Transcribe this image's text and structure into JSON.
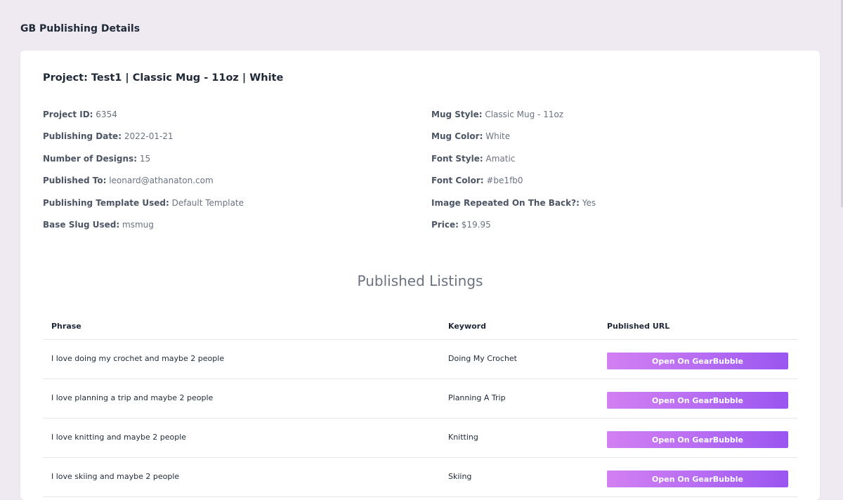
{
  "page": {
    "header": "GB Publishing Details"
  },
  "project": {
    "title": "Project: Test1 | Classic Mug - 11oz | White",
    "left_details": [
      {
        "label": "Project ID:",
        "value": "6354"
      },
      {
        "label": "Publishing Date:",
        "value": "2022-01-21"
      },
      {
        "label": "Number of Designs:",
        "value": "15"
      },
      {
        "label": "Published To:",
        "value": "leonard@athanaton.com"
      },
      {
        "label": "Publishing Template Used:",
        "value": "Default Template"
      },
      {
        "label": "Base Slug Used:",
        "value": "msmug"
      }
    ],
    "right_details": [
      {
        "label": "Mug Style:",
        "value": "Classic Mug - 11oz"
      },
      {
        "label": "Mug Color:",
        "value": "White"
      },
      {
        "label": "Font Style:",
        "value": "Amatic"
      },
      {
        "label": "Font Color:",
        "value": "#be1fb0"
      },
      {
        "label": "Image Repeated On The Back?:",
        "value": "Yes"
      },
      {
        "label": "Price:",
        "value": "$19.95"
      }
    ]
  },
  "listings": {
    "title": "Published Listings",
    "columns": [
      "Phrase",
      "Keyword",
      "Published URL"
    ],
    "button_label": "Open On GearBubble",
    "rows": [
      {
        "phrase": "I love doing my crochet and maybe 2 people",
        "keyword": "Doing My Crochet"
      },
      {
        "phrase": "I love planning a trip and maybe 2 people",
        "keyword": "Planning A Trip"
      },
      {
        "phrase": "I love knitting and maybe 2 people",
        "keyword": "Knitting"
      },
      {
        "phrase": "I love skiing and maybe 2 people",
        "keyword": "Skiing"
      }
    ]
  },
  "colors": {
    "page_background": "#efe9f1",
    "card_background": "#ffffff",
    "button_gradient_start": "#d27ff1",
    "button_gradient_end": "#9a55f0"
  }
}
